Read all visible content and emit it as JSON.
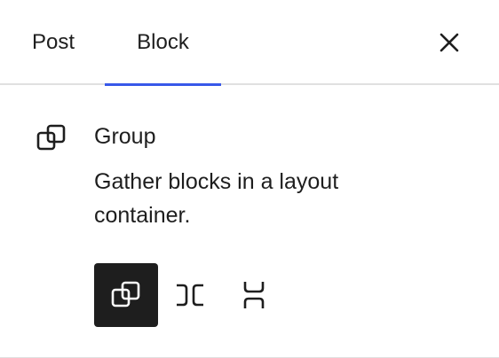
{
  "tabs": [
    {
      "label": "Post",
      "active": false
    },
    {
      "label": "Block",
      "active": true
    }
  ],
  "close_icon": "close-icon",
  "block": {
    "icon": "group-icon",
    "title": "Group",
    "description": "Gather blocks in a layout container."
  },
  "variations": [
    {
      "name": "Group",
      "icon": "group-icon",
      "selected": true
    },
    {
      "name": "Row",
      "icon": "row-icon",
      "selected": false
    },
    {
      "name": "Stack",
      "icon": "stack-icon",
      "selected": false
    }
  ],
  "colors": {
    "accent": "#3858e9",
    "text": "#1e1e1e",
    "selected_bg": "#1e1e1e",
    "divider": "#e0e0e0"
  }
}
